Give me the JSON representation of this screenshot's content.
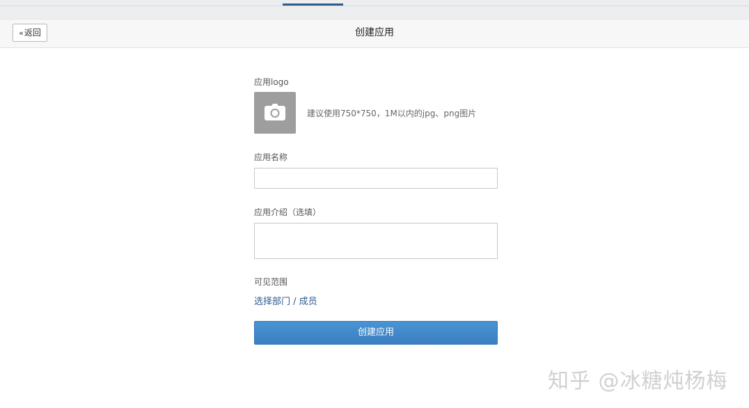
{
  "header": {
    "back_label": "返回",
    "title": "创建应用"
  },
  "form": {
    "logo": {
      "label": "应用logo",
      "hint": "建议使用750*750，1M以内的jpg、png图片",
      "icon": "camera-icon"
    },
    "name": {
      "label": "应用名称",
      "value": "",
      "placeholder": ""
    },
    "intro": {
      "label": "应用介绍（选填）",
      "value": "",
      "placeholder": ""
    },
    "visibility": {
      "label": "可见范围",
      "link": "选择部门 / 成员"
    },
    "submit_label": "创建应用"
  },
  "watermark": "知乎 @冰糖炖杨梅",
  "colors": {
    "accent": "#3a86c8",
    "link": "#2b5c8e",
    "upload_bg": "#9e9e9e"
  }
}
